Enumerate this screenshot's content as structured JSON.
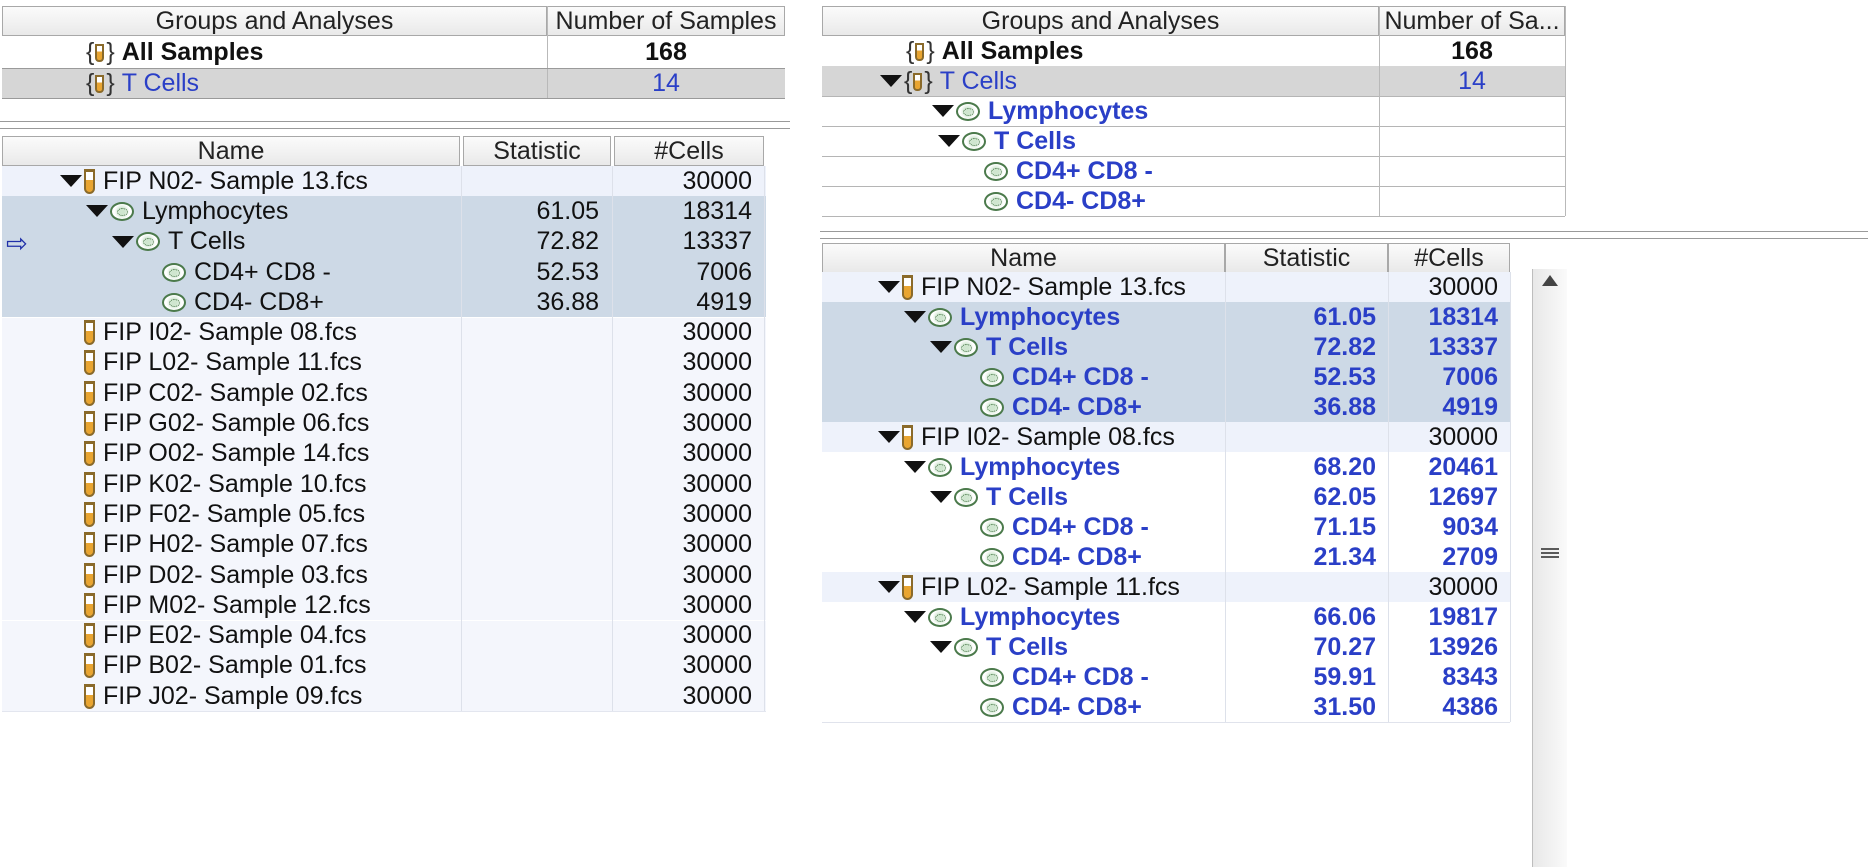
{
  "colors": {
    "selected_row": "#cdd9e6",
    "gray_row": "#d6d6d6",
    "stripe": "#eef2fb",
    "accent_blue": "#2a3fc7"
  },
  "left": {
    "groups": {
      "headers": [
        "Groups and Analyses",
        "Number of Samples"
      ],
      "rows": [
        {
          "icon": "group-icon",
          "label": "All Samples",
          "count": "168"
        },
        {
          "icon": "group-icon",
          "label": "T Cells",
          "count": "14"
        }
      ]
    },
    "samples": {
      "headers": [
        "Name",
        "Statistic",
        "#Cells"
      ],
      "rows": [
        {
          "icon": "tube-icon",
          "label": "FIP N02- Sample 13.fcs",
          "stat": "",
          "cells": "30000"
        },
        {
          "icon": "gate-icon",
          "label": "Lymphocytes",
          "stat": "61.05",
          "cells": "18314"
        },
        {
          "icon": "gate-icon",
          "label": "T Cells",
          "stat": "72.82",
          "cells": "13337"
        },
        {
          "icon": "gate-icon",
          "label": "CD4+ CD8 -",
          "stat": "52.53",
          "cells": "7006"
        },
        {
          "icon": "gate-icon",
          "label": "CD4- CD8+",
          "stat": "36.88",
          "cells": "4919"
        },
        {
          "icon": "tube-icon",
          "label": "FIP I02- Sample 08.fcs",
          "stat": "",
          "cells": "30000"
        },
        {
          "icon": "tube-icon",
          "label": "FIP L02- Sample 11.fcs",
          "stat": "",
          "cells": "30000"
        },
        {
          "icon": "tube-icon",
          "label": "FIP C02- Sample 02.fcs",
          "stat": "",
          "cells": "30000"
        },
        {
          "icon": "tube-icon",
          "label": "FIP G02- Sample 06.fcs",
          "stat": "",
          "cells": "30000"
        },
        {
          "icon": "tube-icon",
          "label": "FIP O02- Sample 14.fcs",
          "stat": "",
          "cells": "30000"
        },
        {
          "icon": "tube-icon",
          "label": "FIP K02- Sample 10.fcs",
          "stat": "",
          "cells": "30000"
        },
        {
          "icon": "tube-icon",
          "label": "FIP F02- Sample 05.fcs",
          "stat": "",
          "cells": "30000"
        },
        {
          "icon": "tube-icon",
          "label": "FIP H02- Sample 07.fcs",
          "stat": "",
          "cells": "30000"
        },
        {
          "icon": "tube-icon",
          "label": "FIP D02- Sample 03.fcs",
          "stat": "",
          "cells": "30000"
        },
        {
          "icon": "tube-icon",
          "label": "FIP M02- Sample 12.fcs",
          "stat": "",
          "cells": "30000"
        },
        {
          "icon": "tube-icon",
          "label": "FIP E02- Sample 04.fcs",
          "stat": "",
          "cells": "30000"
        },
        {
          "icon": "tube-icon",
          "label": "FIP B02- Sample 01.fcs",
          "stat": "",
          "cells": "30000"
        },
        {
          "icon": "tube-icon",
          "label": "FIP J02- Sample 09.fcs",
          "stat": "",
          "cells": "30000"
        }
      ]
    }
  },
  "right": {
    "groups": {
      "headers": [
        "Groups and Analyses",
        "Number of Sa..."
      ],
      "rows": [
        {
          "icon": "group-icon",
          "label": "All Samples",
          "count": "168"
        },
        {
          "icon": "group-icon",
          "label": "T Cells",
          "count": "14"
        },
        {
          "icon": "gate-icon",
          "label": "Lymphocytes",
          "count": ""
        },
        {
          "icon": "gate-icon",
          "label": "T Cells",
          "count": ""
        },
        {
          "icon": "gate-icon",
          "label": "CD4+ CD8 -",
          "count": ""
        },
        {
          "icon": "gate-icon",
          "label": "CD4- CD8+",
          "count": ""
        }
      ]
    },
    "samples": {
      "headers": [
        "Name",
        "Statistic",
        "#Cells"
      ],
      "rows": [
        {
          "icon": "tube-icon",
          "label": "FIP N02- Sample 13.fcs",
          "stat": "",
          "cells": "30000"
        },
        {
          "icon": "gate-icon",
          "label": "Lymphocytes",
          "stat": "61.05",
          "cells": "18314"
        },
        {
          "icon": "gate-icon",
          "label": "T Cells",
          "stat": "72.82",
          "cells": "13337"
        },
        {
          "icon": "gate-icon",
          "label": "CD4+ CD8 -",
          "stat": "52.53",
          "cells": "7006"
        },
        {
          "icon": "gate-icon",
          "label": "CD4- CD8+",
          "stat": "36.88",
          "cells": "4919"
        },
        {
          "icon": "tube-icon",
          "label": "FIP I02- Sample 08.fcs",
          "stat": "",
          "cells": "30000"
        },
        {
          "icon": "gate-icon",
          "label": "Lymphocytes",
          "stat": "68.20",
          "cells": "20461"
        },
        {
          "icon": "gate-icon",
          "label": "T Cells",
          "stat": "62.05",
          "cells": "12697"
        },
        {
          "icon": "gate-icon",
          "label": "CD4+ CD8 -",
          "stat": "71.15",
          "cells": "9034"
        },
        {
          "icon": "gate-icon",
          "label": "CD4- CD8+",
          "stat": "21.34",
          "cells": "2709"
        },
        {
          "icon": "tube-icon",
          "label": "FIP L02- Sample 11.fcs",
          "stat": "",
          "cells": "30000"
        },
        {
          "icon": "gate-icon",
          "label": "Lymphocytes",
          "stat": "66.06",
          "cells": "19817"
        },
        {
          "icon": "gate-icon",
          "label": "T Cells",
          "stat": "70.27",
          "cells": "13926"
        },
        {
          "icon": "gate-icon",
          "label": "CD4+ CD8 -",
          "stat": "59.91",
          "cells": "8343"
        },
        {
          "icon": "gate-icon",
          "label": "CD4- CD8+",
          "stat": "31.50",
          "cells": "4386"
        }
      ]
    }
  }
}
